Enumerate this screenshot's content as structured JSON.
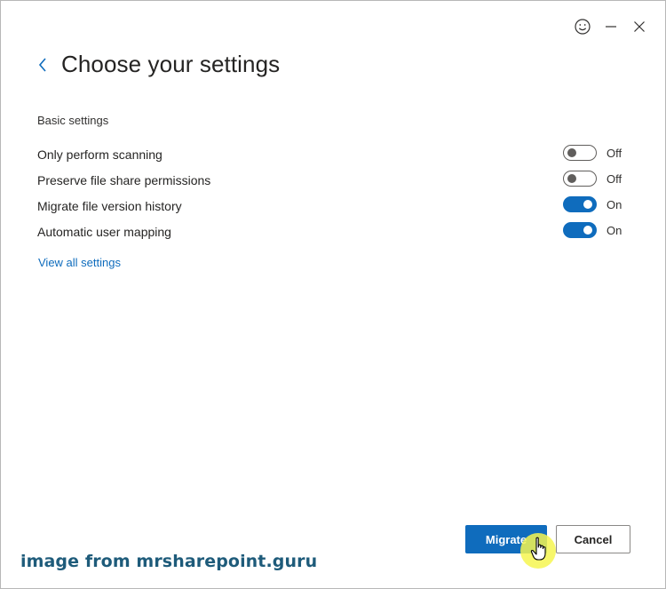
{
  "header": {
    "title": "Choose your settings"
  },
  "section": {
    "label": "Basic settings"
  },
  "settings": [
    {
      "label": "Only perform scanning",
      "state": "Off",
      "on": false
    },
    {
      "label": "Preserve file share permissions",
      "state": "Off",
      "on": false
    },
    {
      "label": "Migrate file version history",
      "state": "On",
      "on": true
    },
    {
      "label": "Automatic user mapping",
      "state": "On",
      "on": true
    }
  ],
  "links": {
    "view_all": "View all settings"
  },
  "footer": {
    "primary_label": "Migrate",
    "secondary_label": "Cancel"
  },
  "watermark": "image from mrsharepoint.guru",
  "colors": {
    "accent": "#0f6cbd",
    "toggle_off": "#605e5c",
    "watermark": "#1e5b7a",
    "cursor_highlight": "#f6f650"
  },
  "icons": {
    "feedback": "smiley-icon",
    "minimize": "minimize-icon",
    "close": "close-icon",
    "back": "chevron-left-icon",
    "cursor": "hand-pointer-icon"
  }
}
